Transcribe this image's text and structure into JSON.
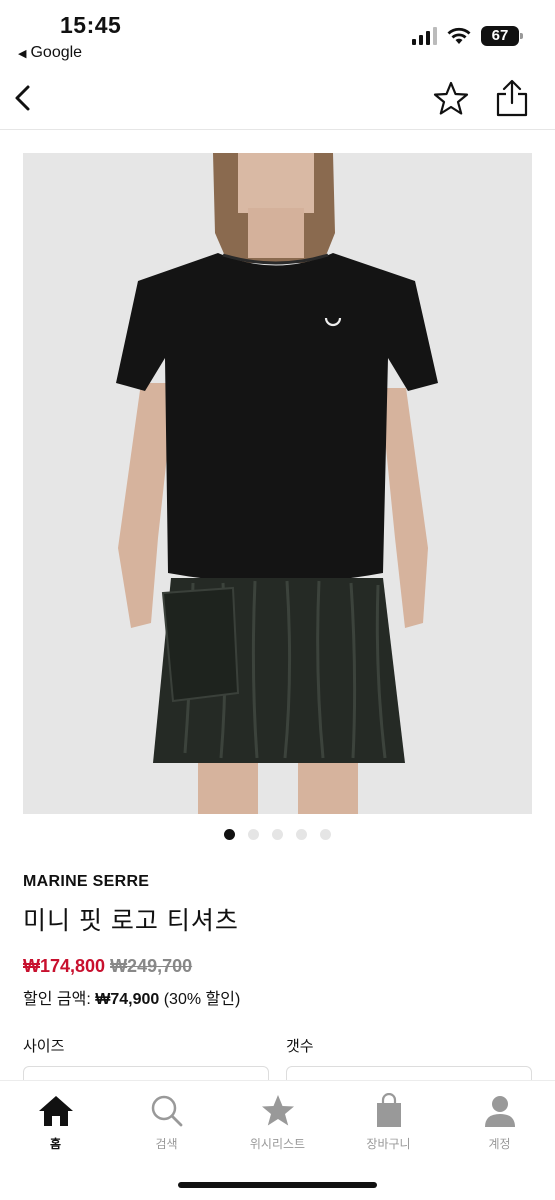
{
  "status_bar": {
    "time": "15:45",
    "back_app_label": "Google",
    "battery": "67"
  },
  "header": {
    "icons": [
      "chevron-left-icon",
      "star-outline-icon",
      "share-icon"
    ]
  },
  "product": {
    "image_pager": {
      "total": 5,
      "active_index": 0
    },
    "brand": "MARINE SERRE",
    "title": "미니 핏 로고 티셔츠",
    "sale_price": "₩174,800",
    "original_price": "₩249,700",
    "discount_text": "할인 금액: ",
    "discount_amount": "₩74,900",
    "discount_percent": " (30% 할인)"
  },
  "options": {
    "size_label": "사이즈",
    "quantity_label": "갯수"
  },
  "tab_bar": {
    "items": [
      {
        "label": "홈",
        "icon": "home-icon",
        "active": true
      },
      {
        "label": "검색",
        "icon": "search-icon",
        "active": false
      },
      {
        "label": "위시리스트",
        "icon": "star-icon",
        "active": false
      },
      {
        "label": "장바구니",
        "icon": "shopping-bag-icon",
        "active": false
      },
      {
        "label": "계정",
        "icon": "user-icon",
        "active": false
      }
    ]
  },
  "colors": {
    "sale_price": "#c8102e",
    "original_price": "#888888",
    "active_tab": "#111111",
    "inactive_tab": "#999999",
    "image_background": "#e6e6e6"
  }
}
